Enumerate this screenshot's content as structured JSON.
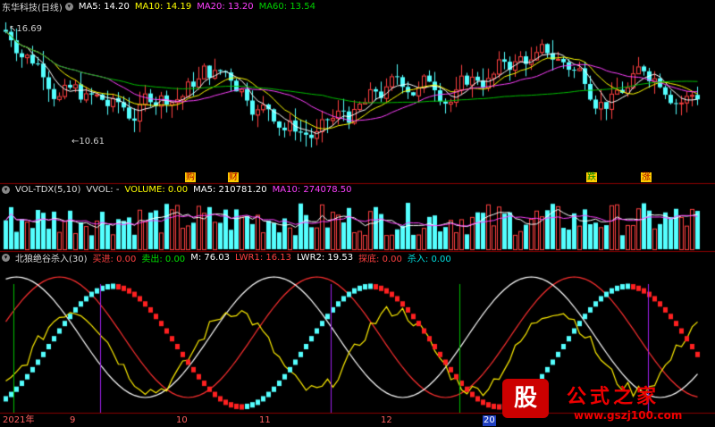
{
  "main": {
    "title": "东华科技(日线)",
    "ma5": "MA5: 14.20",
    "ma10": "MA10: 14.19",
    "ma20": "MA20: 13.20",
    "ma60": "MA60: 13.54",
    "high_label": "16.69",
    "low_label": "10.61",
    "tags": [
      "购",
      "财",
      "跌",
      "涨"
    ]
  },
  "volume": {
    "title": "VOL-TDX(5,10)",
    "vvol": "VVOL: -",
    "volume": "VOLUME: 0.00",
    "ma5": "MA5: 210781.20",
    "ma10": "MA10: 274078.50"
  },
  "indicator": {
    "title": "北狼绝谷杀入(30)",
    "buy": "买进: 0.00",
    "sell": "卖出: 0.00",
    "m": "M: 76.03",
    "lwr1": "LWR1: 16.13",
    "lwr2": "LWR2: 19.53",
    "bottom": "探底: 0.00",
    "kill": "杀入: 0.00"
  },
  "axis": {
    "labels": [
      "2021年",
      "9",
      "10",
      "11",
      "12",
      "20"
    ]
  },
  "logo": {
    "badge": "股",
    "name": "公式之家",
    "url": "www.gszj100.com"
  },
  "colors": {
    "up": "#ff4040",
    "down": "#54ffff",
    "ma5": "#ffffff",
    "ma10": "#ffff00",
    "ma20": "#ff40ff",
    "ma60": "#00c000",
    "grid": "#8b0000"
  }
}
